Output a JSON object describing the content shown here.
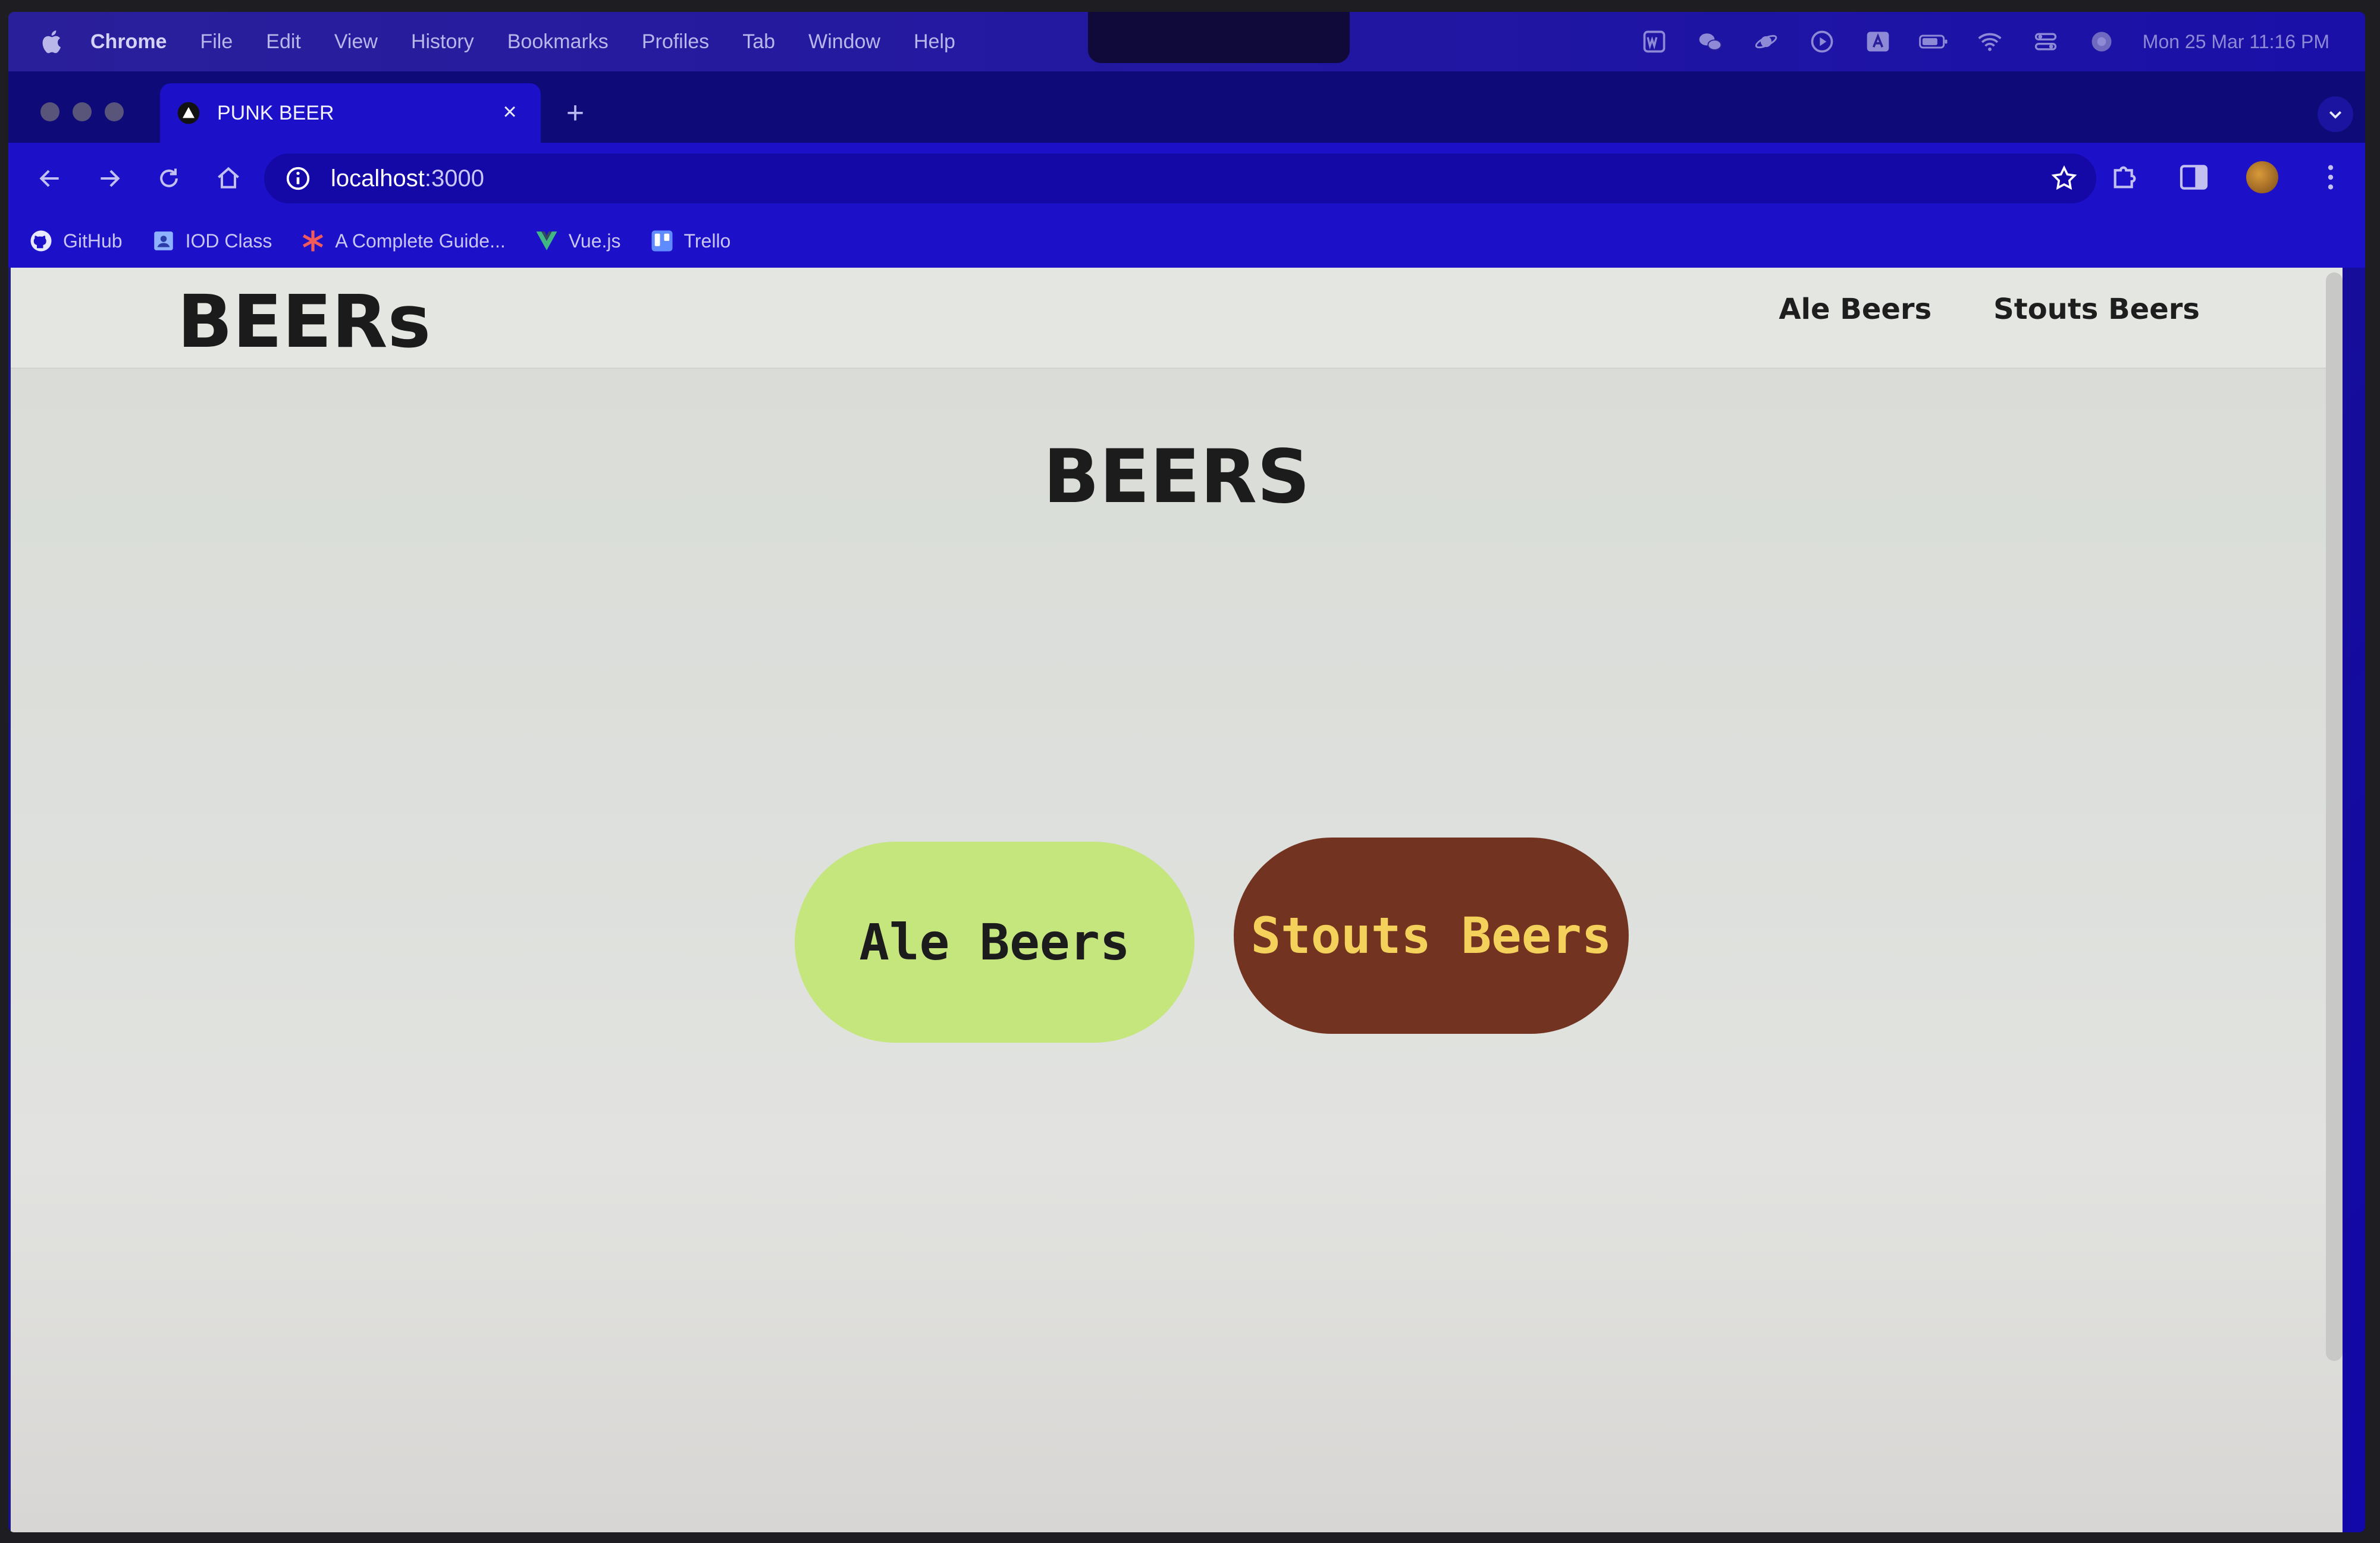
{
  "menubar": {
    "app_name": "Chrome",
    "items": [
      "File",
      "Edit",
      "View",
      "History",
      "Bookmarks",
      "Profiles",
      "Tab",
      "Window",
      "Help"
    ],
    "clock": "Mon 25 Mar  11:16 PM"
  },
  "browser": {
    "tab_title": "PUNK BEER",
    "url_host": "localhost",
    "url_port": ":3000",
    "bookmarks": [
      {
        "label": "GitHub",
        "icon": "github-icon"
      },
      {
        "label": "IOD Class",
        "icon": "contact-card-icon"
      },
      {
        "label": "A Complete Guide...",
        "icon": "asterisk-icon"
      },
      {
        "label": "Vue.js",
        "icon": "vue-logo-icon"
      },
      {
        "label": "Trello",
        "icon": "trello-icon"
      }
    ]
  },
  "site": {
    "brand": "BEERs",
    "nav": [
      "Ale Beers",
      "Stouts Beers"
    ],
    "heading": "BEERS",
    "ale_button": "Ale Beers",
    "stout_button": "Stouts Beers"
  },
  "colors": {
    "ale_button_bg": "#c5e57d",
    "stout_button_bg": "#733321",
    "stout_button_text": "#f3d15a",
    "chrome_theme": "#1c10c8"
  }
}
